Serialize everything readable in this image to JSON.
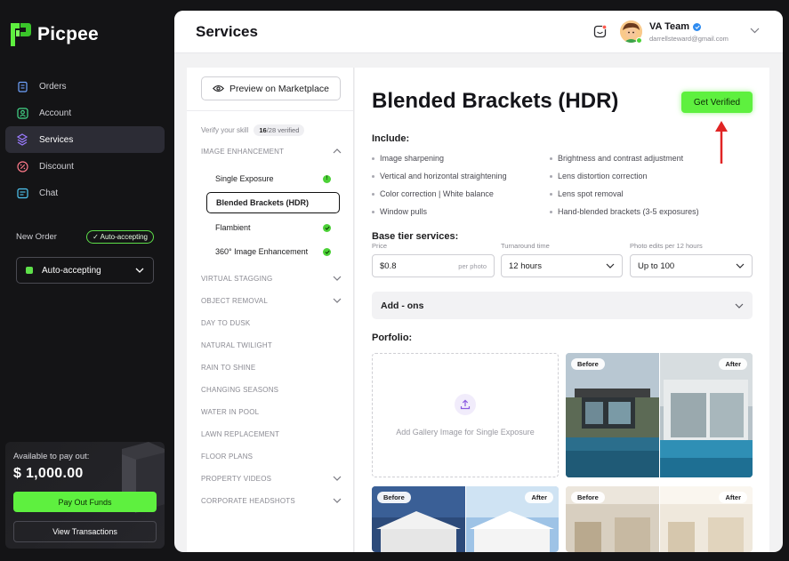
{
  "brand": {
    "name": "Picpee",
    "accent": "#5ef03f"
  },
  "sidebar": {
    "nav": [
      {
        "label": "Orders",
        "icon": "orders-icon"
      },
      {
        "label": "Account",
        "icon": "account-icon"
      },
      {
        "label": "Services",
        "icon": "services-icon",
        "active": true
      },
      {
        "label": "Discount",
        "icon": "discount-icon"
      },
      {
        "label": "Chat",
        "icon": "chat-icon"
      }
    ],
    "new_order_label": "New Order",
    "auto_accept_pill": "Auto-accepting",
    "auto_select_value": "Auto-accepting",
    "payout": {
      "label": "Available to pay out:",
      "amount": "$ 1,000.00",
      "payout_button": "Pay Out Funds",
      "transactions_button": "View Transactions"
    }
  },
  "header": {
    "title": "Services",
    "user_name": "VA Team",
    "user_email": "darrellsteward@gmail.com"
  },
  "left": {
    "preview_button": "Preview on Marketplace",
    "verify_label": "Verify your skill",
    "verify_count_done": "16",
    "verify_count_rest": "/28 verified",
    "categories": [
      "IMAGE ENHANCEMENT",
      "VIRTUAL STAGGING",
      "OBJECT REMOVAL",
      "DAY TO DUSK",
      "NATURAL TWILIGHT",
      "RAIN TO SHINE",
      "CHANGING SEASONS",
      "WATER IN POOL",
      "LAWN REPLACEMENT",
      "FLOOR PLANS",
      "PROPERTY VIDEOS",
      "CORPORATE HEADSHOTS"
    ],
    "sub_items": [
      {
        "label": "Single Exposure",
        "status": "!"
      },
      {
        "label": "Blended Brackets (HDR)",
        "status": ""
      },
      {
        "label": "Flambient",
        "status": "ok"
      },
      {
        "label": "360° Image Enhancement",
        "status": "ok"
      }
    ]
  },
  "content": {
    "title": "Blended Brackets (HDR)",
    "verify_button": "Get Verified",
    "include_heading": "Include:",
    "include_left": [
      "Image sharpening",
      "Vertical and horizontal straightening",
      "Color correction | White balance",
      "Window pulls"
    ],
    "include_right": [
      "Brightness and contrast adjustment",
      "Lens distortion correction",
      "Lens spot removal",
      "Hand-blended brackets (3-5 exposures)"
    ],
    "base_heading": "Base tier services:",
    "price_label": "Price",
    "price_value": "$0.8",
    "price_unit": "per photo",
    "turnaround_label": "Turnaround time",
    "turnaround_value": "12 hours",
    "edits_label": "Photo edits per 12 hours",
    "edits_value": "Up to 100",
    "addons_label": "Add - ons",
    "portfolio_heading": "Porfolio:",
    "upload_text": "Add Gallery Image for Single Exposure",
    "before_label": "Before",
    "after_label": "After"
  }
}
